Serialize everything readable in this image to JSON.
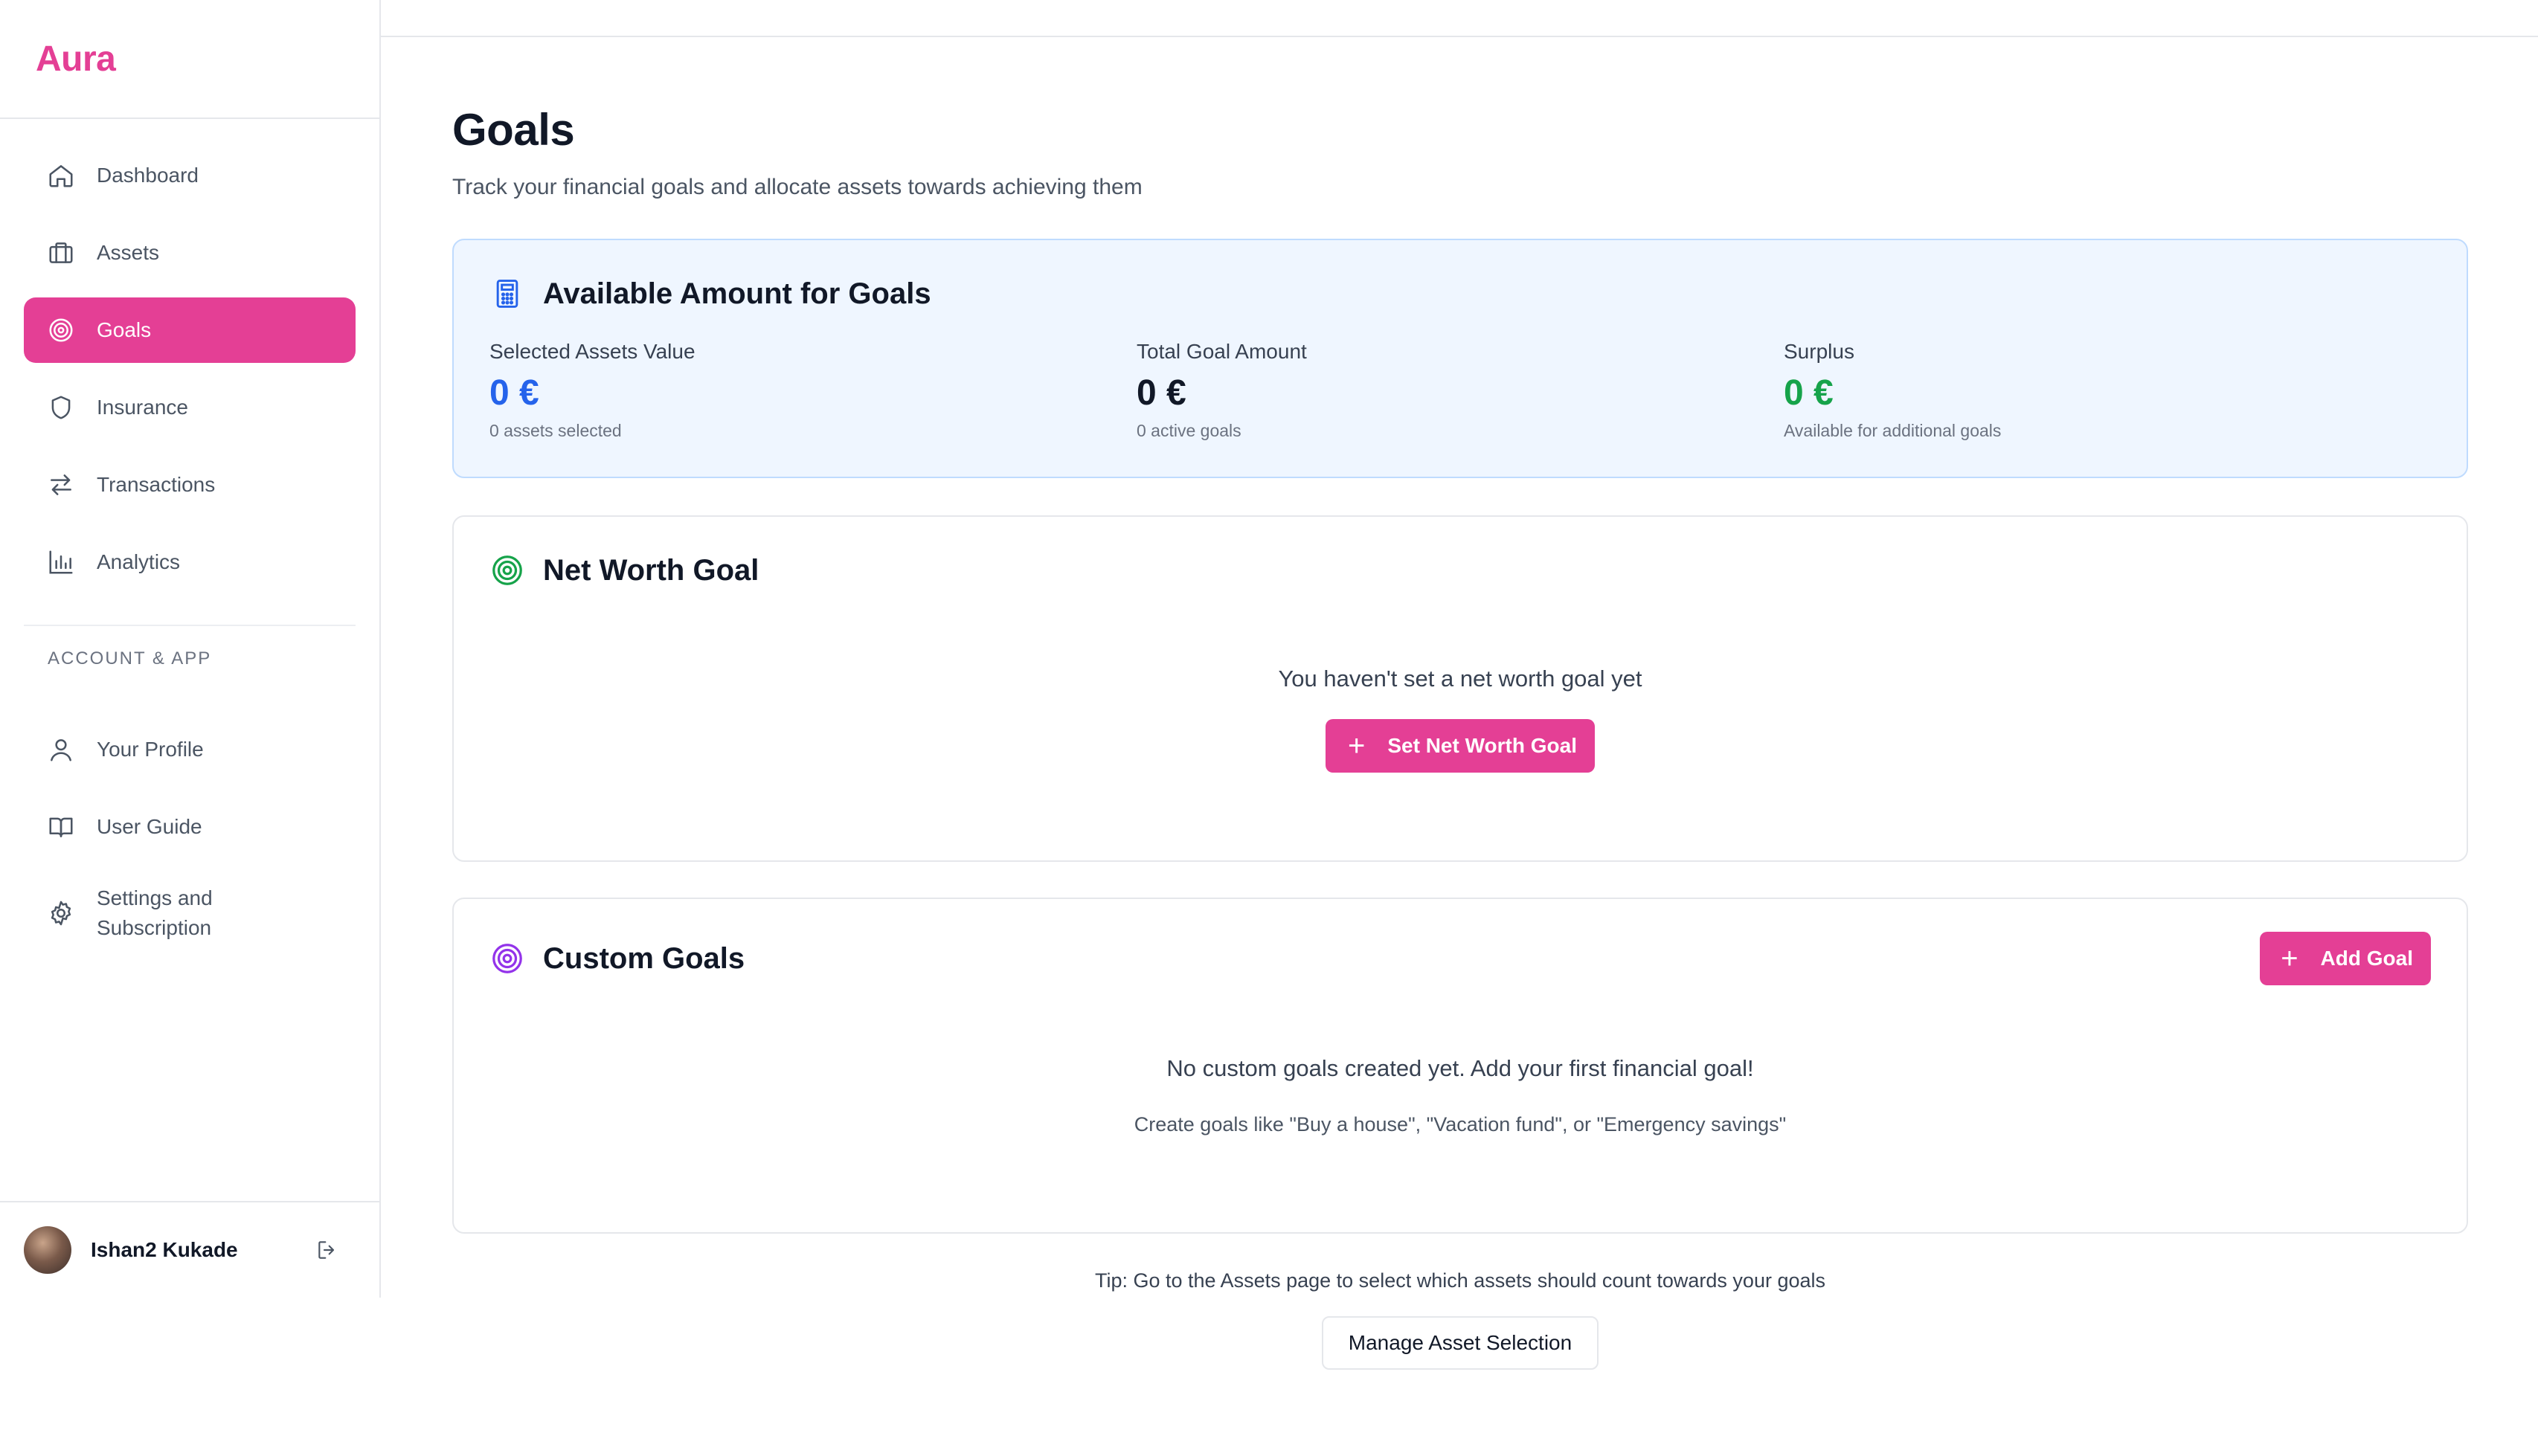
{
  "brand": {
    "name": "Aura",
    "color": "#e43f95"
  },
  "sidebar": {
    "items": [
      {
        "label": "Dashboard",
        "icon": "home-icon"
      },
      {
        "label": "Assets",
        "icon": "briefcase-icon"
      },
      {
        "label": "Goals",
        "icon": "target-icon",
        "active": true
      },
      {
        "label": "Insurance",
        "icon": "shield-icon"
      },
      {
        "label": "Transactions",
        "icon": "arrows-swap-icon"
      },
      {
        "label": "Analytics",
        "icon": "bar-chart-icon"
      }
    ],
    "section_label": "ACCOUNT & APP",
    "account_items": [
      {
        "label": "Your Profile",
        "icon": "user-icon"
      },
      {
        "label": "User Guide",
        "icon": "book-icon"
      },
      {
        "label": "Settings and Subscription",
        "icon": "gear-icon"
      }
    ],
    "user": {
      "name": "Ishan2 Kukade"
    }
  },
  "page": {
    "title": "Goals",
    "subtitle": "Track your financial goals and allocate assets towards achieving them"
  },
  "summary": {
    "title": "Available Amount for Goals",
    "icon": "calculator-icon",
    "stats": [
      {
        "label": "Selected Assets Value",
        "value": "0 €",
        "note": "0 assets selected",
        "color": "#2563eb"
      },
      {
        "label": "Total Goal Amount",
        "value": "0 €",
        "note": "0 active goals",
        "color": "#111827"
      },
      {
        "label": "Surplus",
        "value": "0 €",
        "note": "Available for additional goals",
        "color": "#16a34a"
      }
    ]
  },
  "net_worth": {
    "title": "Net Worth Goal",
    "icon": "target-icon",
    "empty_text": "You haven't set a net worth goal yet",
    "button_label": "Set Net Worth Goal"
  },
  "custom_goals": {
    "title": "Custom Goals",
    "icon": "target-icon",
    "add_label": "Add Goal",
    "empty_text": "No custom goals created yet. Add your first financial goal!",
    "hint": "Create goals like \"Buy a house\", \"Vacation fund\", or \"Emergency savings\""
  },
  "tip": "Tip: Go to the Assets page to select which assets should count towards your goals",
  "manage_button": "Manage Asset Selection",
  "colors": {
    "accent": "#e43f95",
    "blue": "#2563eb",
    "green": "#16a34a",
    "purple": "#9333ea"
  }
}
